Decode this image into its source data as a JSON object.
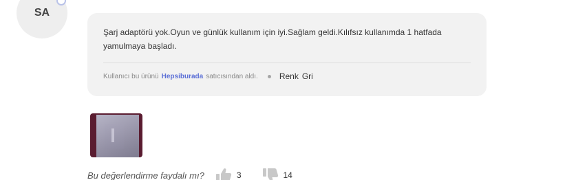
{
  "reviewer": {
    "initials": "SA"
  },
  "review": {
    "text": "Şarj adaptörü yok.Oyun ve günlük kullanım için iyi.Sağlam geldi.Kılıfsız kullanımda 1 hatfada yamulmaya başladı.",
    "purchase_prefix": "Kullanıcı bu ürünü",
    "seller": "Hepsiburada",
    "purchase_suffix": "satıcısından aldı.",
    "variant_label": "Renk",
    "variant_value": "Gri"
  },
  "photo": {
    "icon": "product-photo"
  },
  "helpful": {
    "question": "Bu değerlendirme faydalı mı?",
    "likes": "3",
    "dislikes": "14"
  },
  "colors": {
    "card_background": "#f2f2f2",
    "seller_link": "#5b6fd6",
    "vote_icon": "#c8c8c8"
  }
}
